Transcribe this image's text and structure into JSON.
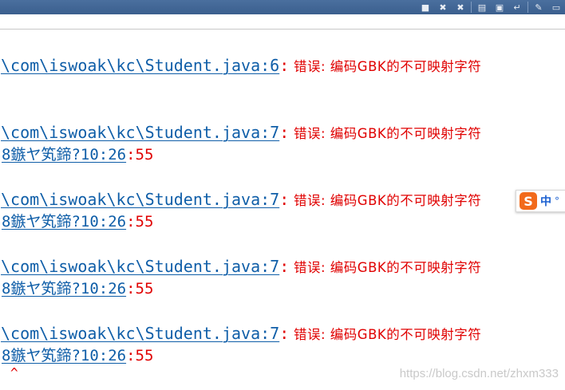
{
  "toolbar": {
    "buttons": [
      {
        "name": "stop-icon",
        "glyph": "■"
      },
      {
        "name": "remove-launch-icon",
        "glyph": "✖"
      },
      {
        "name": "remove-all-icon",
        "glyph": "✖"
      },
      {
        "name": "scroll-lock-icon",
        "glyph": "▤"
      },
      {
        "name": "show-console-icon",
        "glyph": "▣"
      },
      {
        "name": "word-wrap-icon",
        "glyph": "↵"
      },
      {
        "name": "pin-console-icon",
        "glyph": "✎"
      },
      {
        "name": "minimize-icon",
        "glyph": "▭"
      }
    ]
  },
  "console": {
    "lines": [
      {
        "path": "\\com\\iswoak\\kc\\Student.java:6",
        "colon": ":",
        "msg": " 错误: 编码GBK的不可映射字符"
      },
      {
        "path": "\\com\\iswoak\\kc\\Student.java:7",
        "colon": ":",
        "msg": " 错误: 编码GBK的不可映射字符",
        "ts": "8鏃ヤ笂鍗?10:26",
        "ts_tail": ":55"
      },
      {
        "path": "\\com\\iswoak\\kc\\Student.java:7",
        "colon": ":",
        "msg": " 错误: 编码GBK的不可映射字符",
        "ts": "8鏃ヤ笂鍗?10:26",
        "ts_tail": ":55"
      },
      {
        "path": "\\com\\iswoak\\kc\\Student.java:7",
        "colon": ":",
        "msg": " 错误: 编码GBK的不可映射字符",
        "ts": "8鏃ヤ笂鍗?10:26",
        "ts_tail": ":55"
      },
      {
        "path": "\\com\\iswoak\\kc\\Student.java:7",
        "colon": ":",
        "msg": " 错误: 编码GBK的不可映射字符",
        "ts": "8鏃ヤ笂鍗?10:26",
        "ts_tail": ":55"
      }
    ],
    "caret": "^"
  },
  "ime": {
    "logo": "S",
    "mode": "中",
    "dot": "°"
  },
  "watermark": "https://blog.csdn.net/zhxm333"
}
